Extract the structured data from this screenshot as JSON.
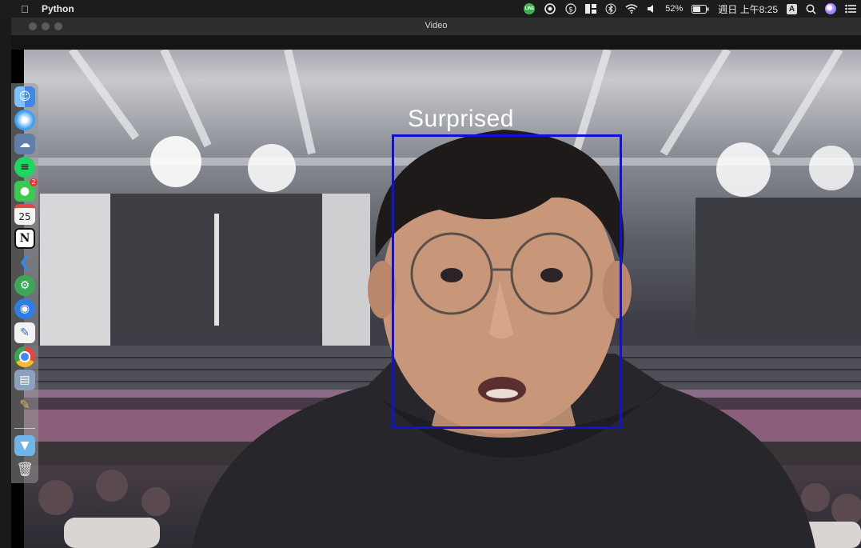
{
  "menubar": {
    "app_name": "Python",
    "battery": "52%",
    "clock": "週日 上午8:25",
    "input_source": "A",
    "line_badge_text": "LINE"
  },
  "window": {
    "title": "Video"
  },
  "video": {
    "emotion_label": "Surprised",
    "box_color": "#1010dc"
  },
  "dock": {
    "calendar_day": "25",
    "notion_letter": "N",
    "line_unread": "2"
  }
}
